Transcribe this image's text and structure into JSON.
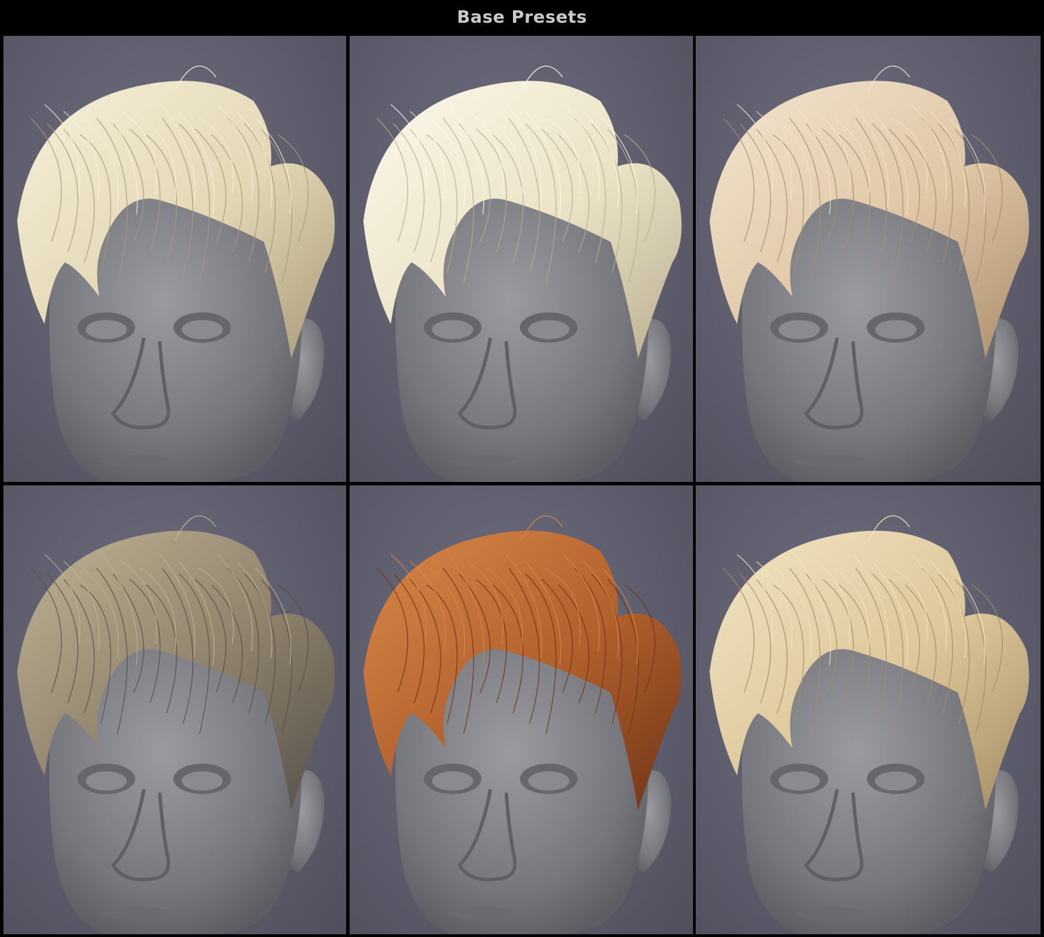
{
  "header": {
    "title": "Base Presets"
  },
  "presets": [
    {
      "hair_color": "#e3d7b4",
      "hair_highlight": "#f7f1dc",
      "hair_shadow": "#a99a78"
    },
    {
      "hair_color": "#ece3c6",
      "hair_highlight": "#fbf8ec",
      "hair_shadow": "#b8ad8f"
    },
    {
      "hair_color": "#e0c7a6",
      "hair_highlight": "#f3e5d0",
      "hair_shadow": "#a98d6d"
    },
    {
      "hair_color": "#8f826c",
      "hair_highlight": "#c1b394",
      "hair_shadow": "#54504a"
    },
    {
      "hair_color": "#b2602c",
      "hair_highlight": "#d8884a",
      "hair_shadow": "#6f3416"
    },
    {
      "hair_color": "#ddc79a",
      "hair_highlight": "#f2e4c4",
      "hair_shadow": "#a48c62"
    }
  ],
  "icons": {
    "mannequin": "mannequin-head-icon"
  }
}
